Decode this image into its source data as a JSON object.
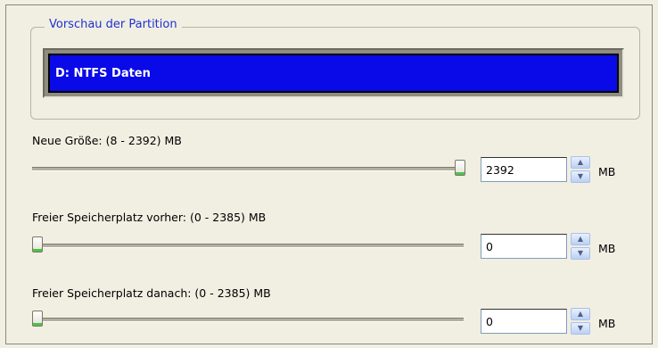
{
  "preview": {
    "legend": "Vorschau der Partition",
    "partition_label": "D: NTFS Daten",
    "partition_color": "#0a09e8"
  },
  "new_size": {
    "label": "Neue Größe: (8 - 2392) MB",
    "value": "2392",
    "unit": "MB",
    "slider_fraction": 1.0
  },
  "free_before": {
    "label": "Freier Speicherplatz vorher: (0 - 2385) MB",
    "value": "0",
    "unit": "MB",
    "slider_fraction": 0.0
  },
  "free_after": {
    "label": "Freier Speicherplatz danach: (0 - 2385) MB",
    "value": "0",
    "unit": "MB",
    "slider_fraction": 0.0
  },
  "icons": {
    "spin_up": "chevron-up-icon",
    "spin_down": "chevron-down-icon"
  }
}
